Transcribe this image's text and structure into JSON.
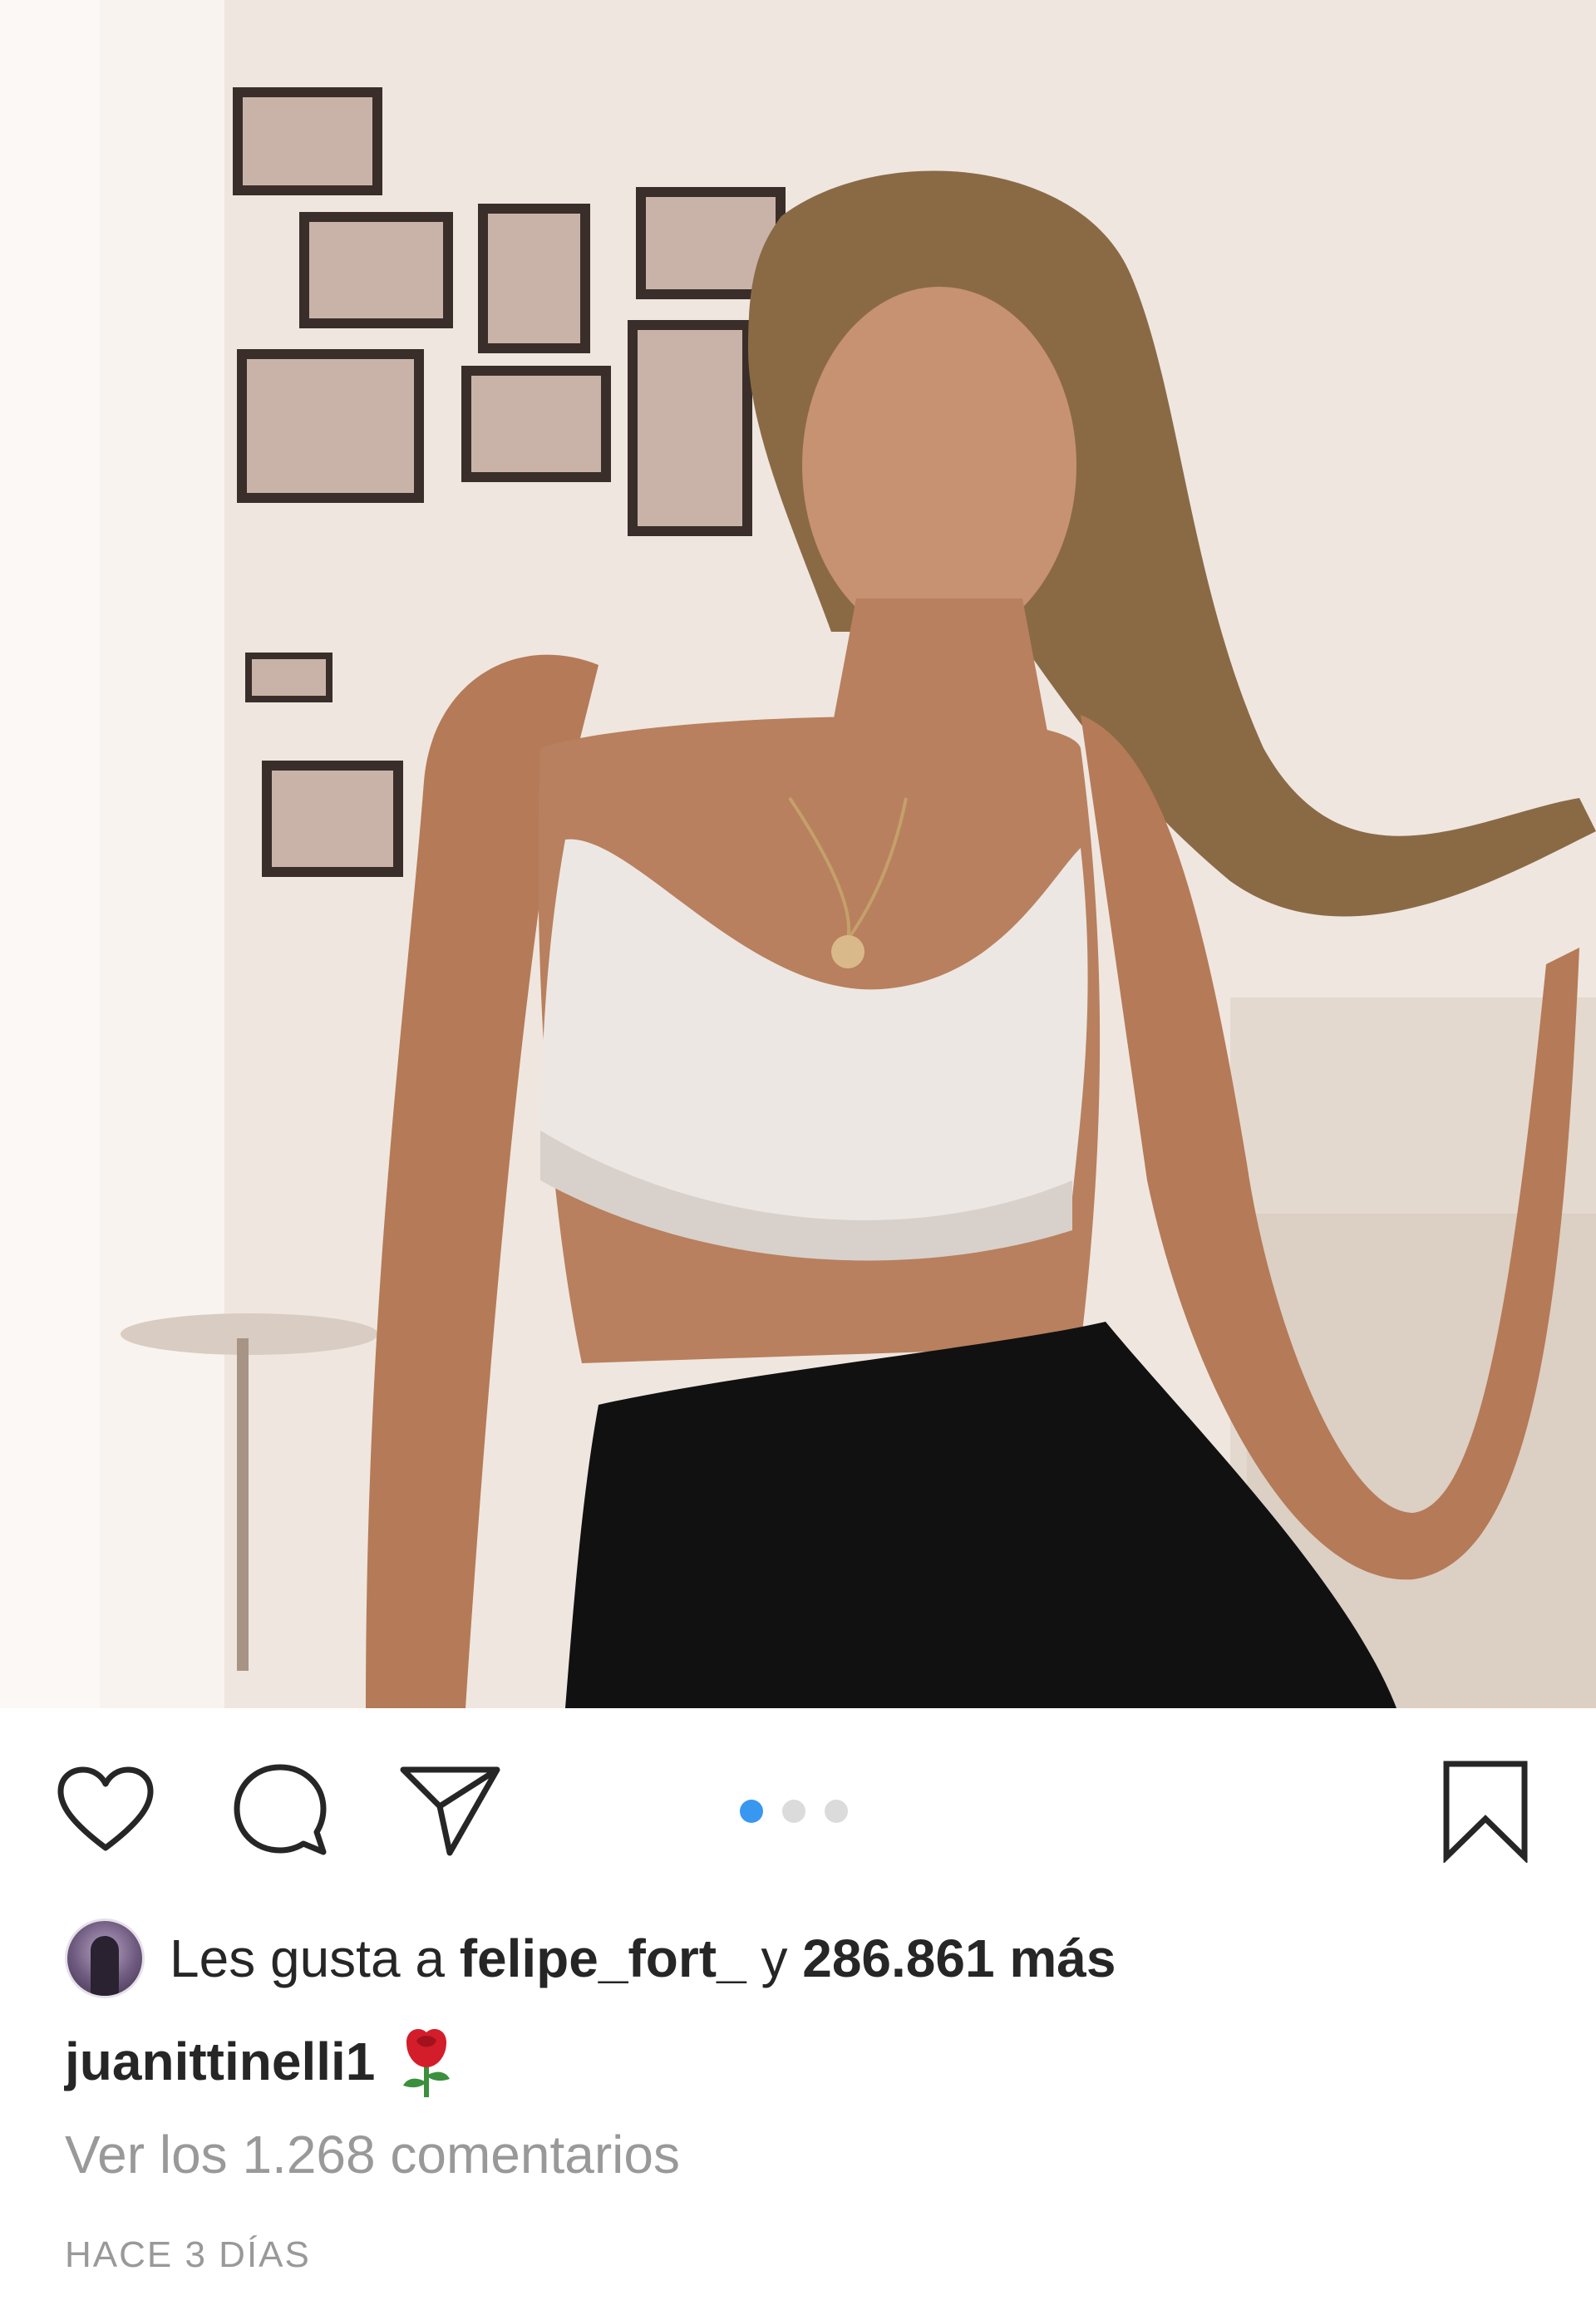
{
  "post": {
    "image": {
      "alt": "",
      "carousel_index": 1,
      "carousel_total": 3
    },
    "actions": {
      "like_icon": "heart-icon",
      "comment_icon": "comment-bubble-icon",
      "share_icon": "paper-plane-icon",
      "save_icon": "bookmark-icon"
    },
    "likes": {
      "prefix": "Les gusta a",
      "user": "felipe_fort_",
      "separator": "y",
      "count": "286.861 más"
    },
    "caption": {
      "user": "juanittinelli1",
      "emoji_icon": "rose-emoji-icon"
    },
    "comments_link": "Ver los 1.268 comentarios",
    "timestamp": "HACE 3 DÍAS"
  },
  "colors": {
    "text_primary": "#262626",
    "text_secondary": "#999999",
    "carousel_active": "#3897f0",
    "carousel_inactive": "#dbdbdb"
  }
}
